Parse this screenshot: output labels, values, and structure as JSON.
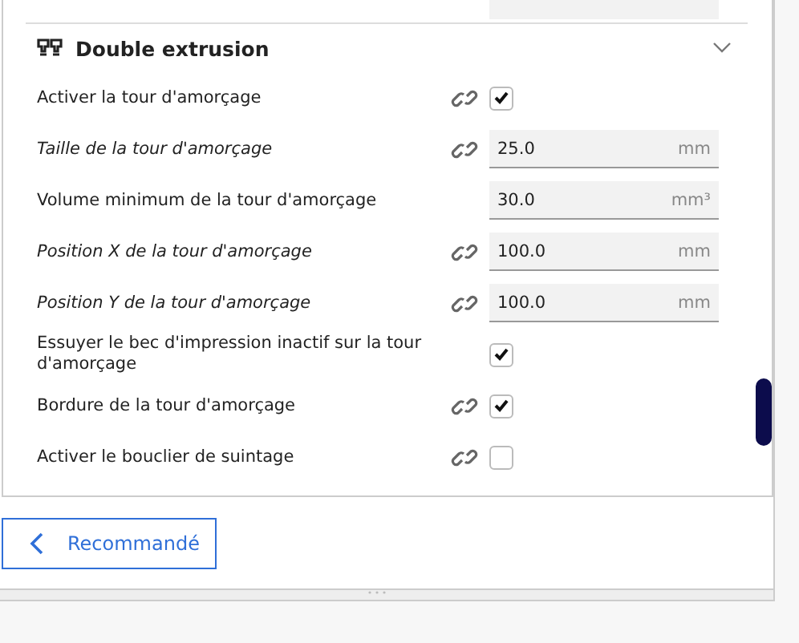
{
  "section": {
    "title": "Double extrusion",
    "expanded": true
  },
  "settings": [
    {
      "label": "Activer la tour d'amorçage",
      "italic": false,
      "linked": true,
      "kind": "checkbox",
      "checked": true
    },
    {
      "label": "Taille de la tour d'amorçage",
      "italic": true,
      "linked": true,
      "kind": "field",
      "value": "25.0",
      "unit": "mm"
    },
    {
      "label": "Volume minimum de la tour d'amorçage",
      "italic": false,
      "linked": false,
      "kind": "field",
      "value": "30.0",
      "unit": "mm³"
    },
    {
      "label": "Position X de la tour d'amorçage",
      "italic": true,
      "linked": true,
      "kind": "field",
      "value": "100.0",
      "unit": "mm"
    },
    {
      "label": "Position Y de la tour d'amorçage",
      "italic": true,
      "linked": true,
      "kind": "field",
      "value": "100.0",
      "unit": "mm"
    },
    {
      "label": "Essuyer le bec d'impression inactif sur la tour d'amorçage",
      "italic": false,
      "linked": false,
      "kind": "checkbox",
      "checked": true
    },
    {
      "label": "Bordure de la tour d'amorçage",
      "italic": false,
      "linked": true,
      "kind": "checkbox",
      "checked": true
    },
    {
      "label": "Activer le bouclier de suintage",
      "italic": false,
      "linked": true,
      "kind": "checkbox",
      "checked": false
    }
  ],
  "back_button": {
    "label": "Recommandé"
  }
}
